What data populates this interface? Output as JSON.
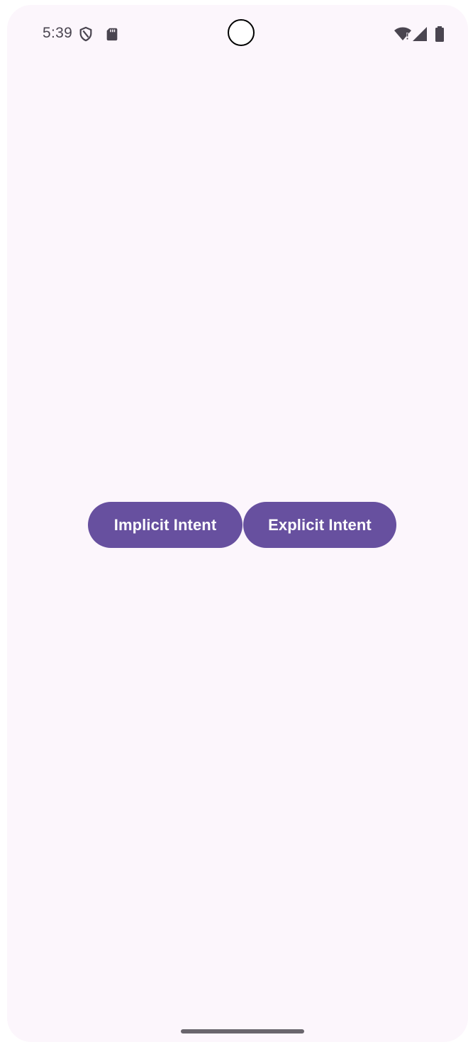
{
  "status_bar": {
    "time": "5:39",
    "icons_left": [
      "shield-icon",
      "sd-card-icon"
    ],
    "icons_right": [
      "wifi-alert-icon",
      "cell-signal-icon",
      "battery-icon"
    ]
  },
  "main": {
    "buttons": [
      {
        "label": "Implicit Intent"
      },
      {
        "label": "Explicit Intent"
      }
    ]
  },
  "colors": {
    "background": "#fcf6fc",
    "button": "#67509f",
    "button_text": "#ffffff",
    "status_text": "#4a4550",
    "home_indicator": "#6a666d"
  }
}
